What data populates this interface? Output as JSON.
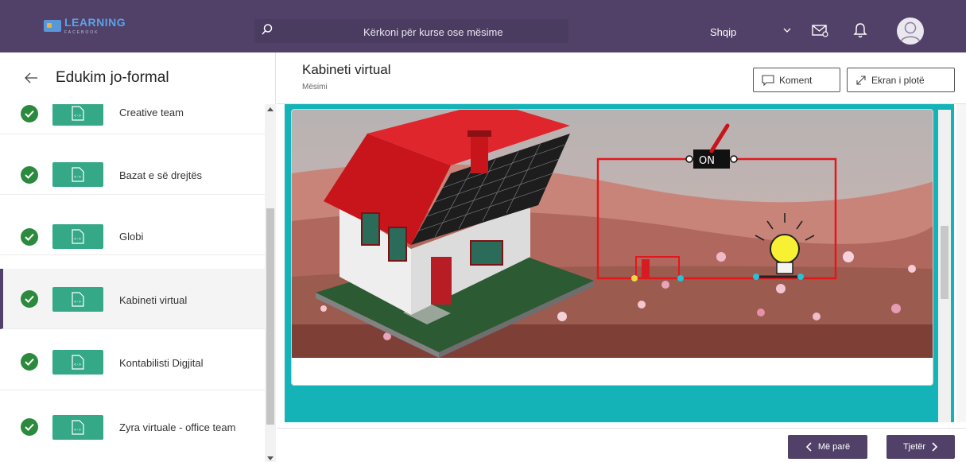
{
  "header": {
    "logo_text": "LEARNING",
    "logo_sub": "FACEBOOK",
    "search_placeholder": "Kërkoni për kurse ose mësime",
    "language": "Shqip",
    "icons": [
      "search-icon",
      "chevron-down-icon",
      "mail-icon",
      "bell-icon",
      "avatar-icon"
    ],
    "colors": {
      "topbar": "#514168",
      "accent": "#35a888",
      "check": "#2b8a3e",
      "viewer_bg": "#13b3b8"
    }
  },
  "sidebar": {
    "title": "Edukim jo-formal",
    "items": [
      {
        "label": "Creative team",
        "completed": true
      },
      {
        "label": "Bazat e së drejtës",
        "completed": true
      },
      {
        "label": "Globi",
        "completed": true
      },
      {
        "label": "Kabineti virtual",
        "completed": true,
        "active": true
      },
      {
        "label": "Kontabilisti Digjital",
        "completed": true
      },
      {
        "label": "Zyra virtuale - office team",
        "completed": true
      }
    ]
  },
  "main": {
    "title": "Kabineti virtual",
    "subtitle": "Mësimi",
    "comment_label": "Koment",
    "fullscreen_label": "Ekran i plotë",
    "scene": {
      "switch_label": "ON"
    }
  },
  "footer": {
    "prev_label": "Më parë",
    "next_label": "Tjetër"
  }
}
